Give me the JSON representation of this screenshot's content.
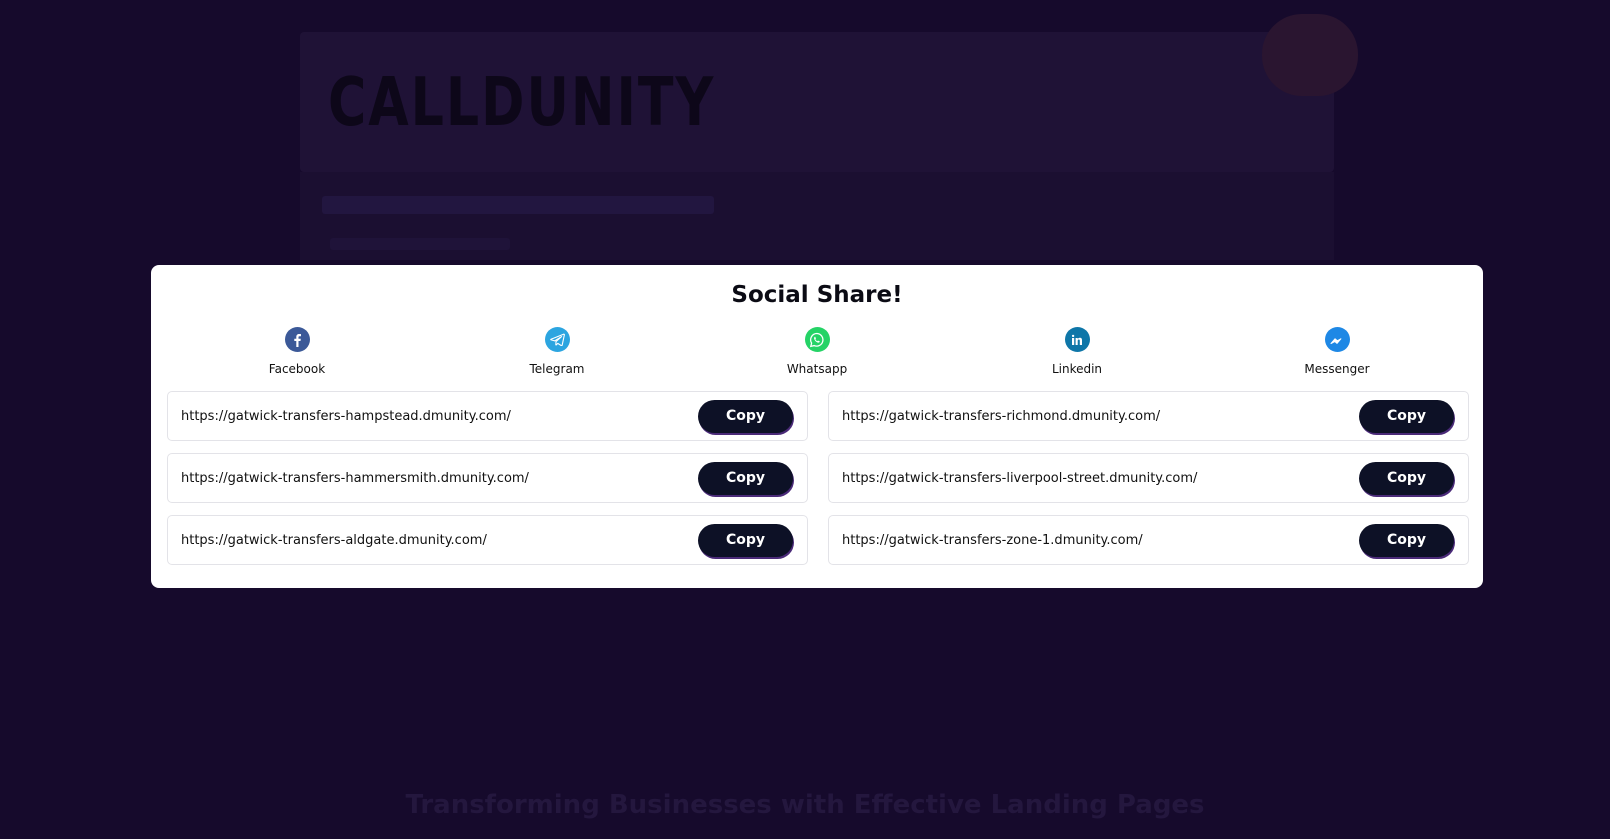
{
  "modal": {
    "title": "Social Share!",
    "socials": [
      {
        "label": "Facebook",
        "icon": "facebook-icon",
        "color": "#3b5998"
      },
      {
        "label": "Telegram",
        "icon": "telegram-icon",
        "color": "#2ca5e0"
      },
      {
        "label": "Whatsapp",
        "icon": "whatsapp-icon",
        "color": "#25d366"
      },
      {
        "label": "Linkedin",
        "icon": "linkedin-icon",
        "color": "#0e76a8"
      },
      {
        "label": "Messenger",
        "icon": "messenger-icon",
        "color": "#1e88e5"
      }
    ],
    "links": [
      {
        "url": "https://gatwick-transfers-hampstead.dmunity.com/",
        "button": "Copy"
      },
      {
        "url": "https://gatwick-transfers-richmond.dmunity.com/",
        "button": "Copy"
      },
      {
        "url": "https://gatwick-transfers-hammersmith.dmunity.com/",
        "button": "Copy"
      },
      {
        "url": "https://gatwick-transfers-liverpool-street.dmunity.com/",
        "button": "Copy"
      },
      {
        "url": "https://gatwick-transfers-aldgate.dmunity.com/",
        "button": "Copy"
      },
      {
        "url": "https://gatwick-transfers-zone-1.dmunity.com/",
        "button": "Copy"
      }
    ]
  },
  "background": {
    "logo": "CALLDUNITY",
    "bottom_title": "Transforming Businesses with Effective Landing Pages"
  },
  "colors": {
    "overlay": "#160a2c",
    "button": "#0d1126"
  }
}
